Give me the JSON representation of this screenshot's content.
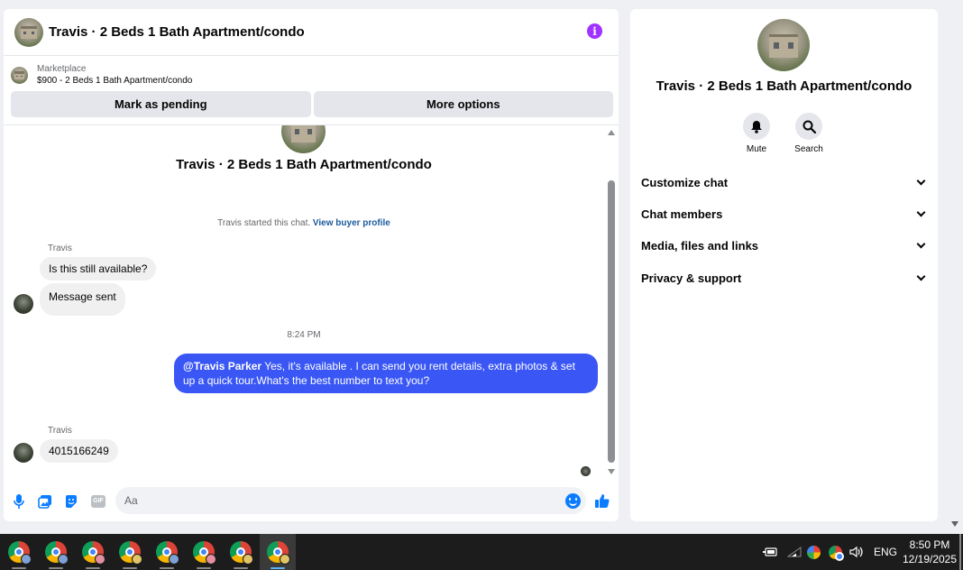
{
  "chat": {
    "title": "Travis · 2 Beds 1 Bath Apartment/condo",
    "info_glyph": "i",
    "marketplace_label": "Marketplace",
    "listing": "$900 - 2 Beds 1 Bath Apartment/condo",
    "mark_pending_label": "Mark as pending",
    "more_options_label": "More options",
    "center_title": "Travis · 2 Beds 1 Bath Apartment/condo",
    "started_text": "Travis started this chat. ",
    "view_buyer_profile": "View buyer profile",
    "messages": [
      {
        "sender": "Travis",
        "text": "Is this still available?"
      },
      {
        "text": "Message sent"
      },
      {
        "timestamp": "8:24 PM"
      },
      {
        "mention": "@Travis Parker",
        "text": " Yes, it's available .  I can send you rent details, extra photos & set up a quick tour.What's the best number to text you?"
      },
      {
        "sender": "Travis",
        "text": "4015166249"
      }
    ],
    "composer_placeholder": "Aa",
    "gif_label": "GIF"
  },
  "side": {
    "title": "Travis · 2 Beds 1 Bath Apartment/condo",
    "mute_label": "Mute",
    "search_label": "Search",
    "sections": [
      "Customize chat",
      "Chat members",
      "Media, files and links",
      "Privacy & support"
    ]
  },
  "taskbar": {
    "apps": [
      {
        "icon": "chrome-icon",
        "profile_color": "#7ea1d6"
      },
      {
        "icon": "chrome-icon",
        "profile_color": "#7ea1d6"
      },
      {
        "icon": "chrome-icon",
        "profile_color": "#e58fa4"
      },
      {
        "icon": "chrome-icon",
        "profile_color": "#e2c46a"
      },
      {
        "icon": "chrome-icon",
        "profile_color": "#7ea1d6"
      },
      {
        "icon": "chrome-icon",
        "profile_color": "#e58fa4"
      },
      {
        "icon": "chrome-icon",
        "profile_color": "#e2c46a"
      },
      {
        "icon": "chrome-icon",
        "profile_color": "#e2c46a",
        "active": true
      }
    ],
    "language": "ENG",
    "time": "8:50 PM",
    "date": "12/19/2025"
  },
  "colors": {
    "accent": "#0a7cff",
    "outgoing_bubble": "#3a57f5",
    "info": "#a033ff"
  }
}
